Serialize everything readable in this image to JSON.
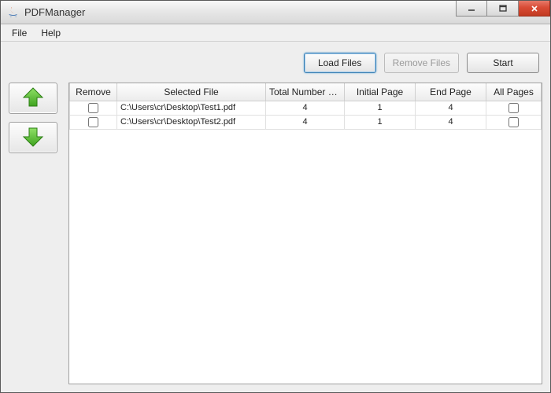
{
  "window": {
    "title": "PDFManager"
  },
  "menu": {
    "file": "File",
    "help": "Help"
  },
  "toolbar": {
    "load": "Load Files",
    "remove": "Remove Files",
    "start": "Start"
  },
  "table": {
    "headers": {
      "remove": "Remove",
      "file": "Selected File",
      "total": "Total Number of...",
      "initial": "Initial Page",
      "end": "End Page",
      "all": "All Pages"
    },
    "rows": [
      {
        "remove": false,
        "file": "C:\\Users\\cr\\Desktop\\Test1.pdf",
        "total": "4",
        "initial": "1",
        "end": "4",
        "all": false
      },
      {
        "remove": false,
        "file": "C:\\Users\\cr\\Desktop\\Test2.pdf",
        "total": "4",
        "initial": "1",
        "end": "4",
        "all": false
      }
    ]
  },
  "icons": {
    "up": "move-up-icon",
    "down": "move-down-icon"
  }
}
